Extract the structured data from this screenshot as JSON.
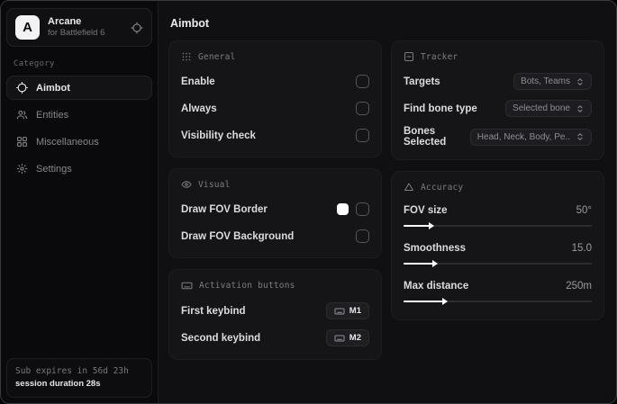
{
  "app": {
    "logo_letter": "A",
    "title": "Arcane",
    "subtitle": "for Battlefield 6"
  },
  "sidebar": {
    "category_label": "Category",
    "items": [
      {
        "label": "Aimbot",
        "icon": "crosshair-icon",
        "active": true
      },
      {
        "label": "Entities",
        "icon": "users-icon",
        "active": false
      },
      {
        "label": "Miscellaneous",
        "icon": "grid-icon",
        "active": false
      },
      {
        "label": "Settings",
        "icon": "gear-icon",
        "active": false
      }
    ],
    "footer": {
      "sub_expires": "Sub expires in 56d 23h",
      "session_duration": "session duration 28s"
    }
  },
  "main": {
    "title": "Aimbot",
    "general": {
      "title": "General",
      "rows": [
        {
          "label": "Enable",
          "checked": false
        },
        {
          "label": "Always",
          "checked": false
        },
        {
          "label": "Visibility check",
          "checked": false
        }
      ]
    },
    "visual": {
      "title": "Visual",
      "rows": [
        {
          "label": "Draw FOV Border",
          "checked": false,
          "swatch_color": "#ffffff"
        },
        {
          "label": "Draw FOV Background",
          "checked": false
        }
      ]
    },
    "activation": {
      "title": "Activation buttons",
      "rows": [
        {
          "label": "First keybind",
          "key": "M1"
        },
        {
          "label": "Second keybind",
          "key": "M2"
        }
      ]
    },
    "tracker": {
      "title": "Tracker",
      "rows": [
        {
          "label": "Targets",
          "value": "Bots, Teams"
        },
        {
          "label": "Find bone type",
          "value": "Selected bone"
        },
        {
          "label": "Bones Selected",
          "value": "Head, Neck, Body, Pe.."
        }
      ]
    },
    "accuracy": {
      "title": "Accuracy",
      "rows": [
        {
          "label": "FOV size",
          "value": "50°",
          "percent": 14
        },
        {
          "label": "Smoothness",
          "value": "15.0",
          "percent": 16
        },
        {
          "label": "Max distance",
          "value": "250m",
          "percent": 21
        }
      ]
    }
  },
  "colors": {
    "accent": "#ffffff",
    "background": "#0a0a0c",
    "panel": "#151518"
  }
}
